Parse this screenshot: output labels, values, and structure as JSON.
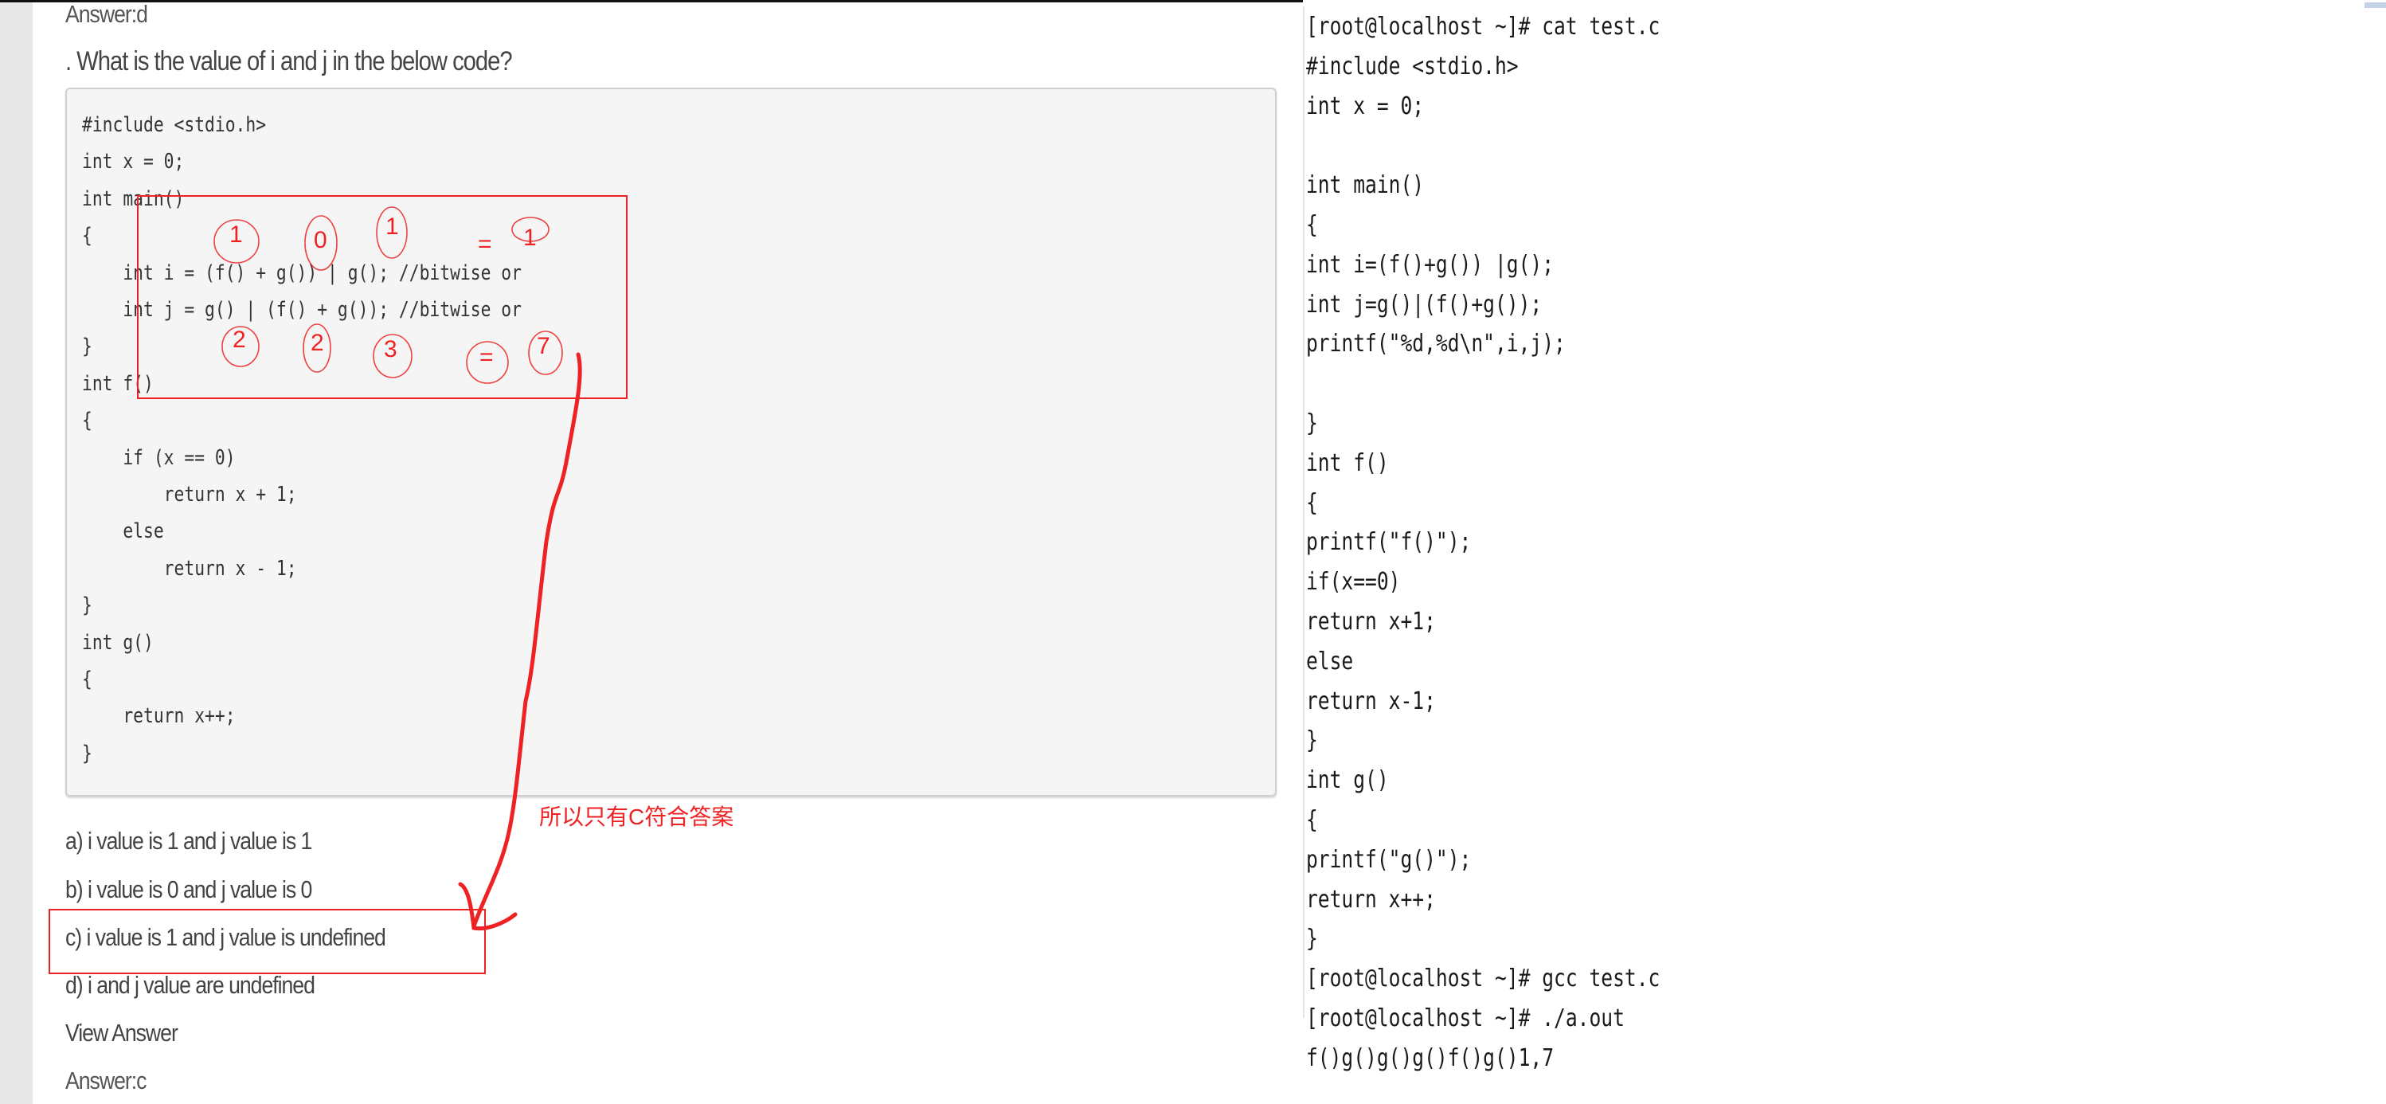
{
  "left": {
    "prev_answer": "Answer:d",
    "question": ". What is the value of i and j in the below code?",
    "code_lines": [
      "#include <stdio.h>",
      "int x = 0;",
      "int main()",
      "{",
      "    int i = (f() + g()) | g(); //bitwise or",
      "    int j = g() | (f() + g()); //bitwise or",
      "}",
      "int f()",
      "{",
      "    if (x == 0)",
      "        return x + 1;",
      "    else",
      "        return x - 1;",
      "}",
      "int g()",
      "{",
      "    return x++;",
      "}"
    ],
    "options": [
      "a) i value is 1 and j value is 1",
      "b) i value is 0 and j value is 0",
      "c) i value is 1 and j value is undefined",
      "d) i and j value are undefined"
    ],
    "view_answer": "View Answer",
    "answer": "Answer:c"
  },
  "annotations": {
    "i_values": [
      "1",
      "0",
      "1",
      "=",
      "1"
    ],
    "j_values": [
      "2",
      "2",
      "3",
      "=",
      "7"
    ],
    "note": "所以只有C符合答案",
    "color": "#ee2222"
  },
  "terminal": {
    "lines": [
      "[root@localhost ~]# cat test.c",
      "#include <stdio.h>",
      "int x = 0;",
      "",
      "int main()",
      "{",
      "int i=(f()+g()) |g();",
      "int j=g()|(f()+g());",
      "printf(\"%d,%d\\n\",i,j);",
      "",
      "}",
      "int f()",
      "{",
      "printf(\"f()\");",
      "if(x==0)",
      "return x+1;",
      "else",
      "return x-1;",
      "}",
      "int g()",
      "{",
      "printf(\"g()\");",
      "return x++;",
      "}",
      "[root@localhost ~]# gcc test.c",
      "[root@localhost ~]# ./a.out",
      "f()g()g()g()f()g()1,7"
    ]
  }
}
